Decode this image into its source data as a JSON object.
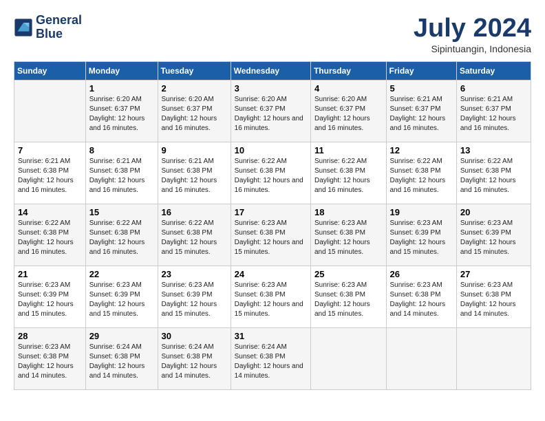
{
  "logo": {
    "line1": "General",
    "line2": "Blue"
  },
  "title": "July 2024",
  "subtitle": "Sipintuangin, Indonesia",
  "weekdays": [
    "Sunday",
    "Monday",
    "Tuesday",
    "Wednesday",
    "Thursday",
    "Friday",
    "Saturday"
  ],
  "weeks": [
    [
      {
        "day": "",
        "info": ""
      },
      {
        "day": "1",
        "info": "Sunrise: 6:20 AM\nSunset: 6:37 PM\nDaylight: 12 hours and 16 minutes."
      },
      {
        "day": "2",
        "info": "Sunrise: 6:20 AM\nSunset: 6:37 PM\nDaylight: 12 hours and 16 minutes."
      },
      {
        "day": "3",
        "info": "Sunrise: 6:20 AM\nSunset: 6:37 PM\nDaylight: 12 hours and 16 minutes."
      },
      {
        "day": "4",
        "info": "Sunrise: 6:20 AM\nSunset: 6:37 PM\nDaylight: 12 hours and 16 minutes."
      },
      {
        "day": "5",
        "info": "Sunrise: 6:21 AM\nSunset: 6:37 PM\nDaylight: 12 hours and 16 minutes."
      },
      {
        "day": "6",
        "info": "Sunrise: 6:21 AM\nSunset: 6:37 PM\nDaylight: 12 hours and 16 minutes."
      }
    ],
    [
      {
        "day": "7",
        "info": "Sunrise: 6:21 AM\nSunset: 6:38 PM\nDaylight: 12 hours and 16 minutes."
      },
      {
        "day": "8",
        "info": "Sunrise: 6:21 AM\nSunset: 6:38 PM\nDaylight: 12 hours and 16 minutes."
      },
      {
        "day": "9",
        "info": "Sunrise: 6:21 AM\nSunset: 6:38 PM\nDaylight: 12 hours and 16 minutes."
      },
      {
        "day": "10",
        "info": "Sunrise: 6:22 AM\nSunset: 6:38 PM\nDaylight: 12 hours and 16 minutes."
      },
      {
        "day": "11",
        "info": "Sunrise: 6:22 AM\nSunset: 6:38 PM\nDaylight: 12 hours and 16 minutes."
      },
      {
        "day": "12",
        "info": "Sunrise: 6:22 AM\nSunset: 6:38 PM\nDaylight: 12 hours and 16 minutes."
      },
      {
        "day": "13",
        "info": "Sunrise: 6:22 AM\nSunset: 6:38 PM\nDaylight: 12 hours and 16 minutes."
      }
    ],
    [
      {
        "day": "14",
        "info": "Sunrise: 6:22 AM\nSunset: 6:38 PM\nDaylight: 12 hours and 16 minutes."
      },
      {
        "day": "15",
        "info": "Sunrise: 6:22 AM\nSunset: 6:38 PM\nDaylight: 12 hours and 16 minutes."
      },
      {
        "day": "16",
        "info": "Sunrise: 6:22 AM\nSunset: 6:38 PM\nDaylight: 12 hours and 15 minutes."
      },
      {
        "day": "17",
        "info": "Sunrise: 6:23 AM\nSunset: 6:38 PM\nDaylight: 12 hours and 15 minutes."
      },
      {
        "day": "18",
        "info": "Sunrise: 6:23 AM\nSunset: 6:38 PM\nDaylight: 12 hours and 15 minutes."
      },
      {
        "day": "19",
        "info": "Sunrise: 6:23 AM\nSunset: 6:39 PM\nDaylight: 12 hours and 15 minutes."
      },
      {
        "day": "20",
        "info": "Sunrise: 6:23 AM\nSunset: 6:39 PM\nDaylight: 12 hours and 15 minutes."
      }
    ],
    [
      {
        "day": "21",
        "info": "Sunrise: 6:23 AM\nSunset: 6:39 PM\nDaylight: 12 hours and 15 minutes."
      },
      {
        "day": "22",
        "info": "Sunrise: 6:23 AM\nSunset: 6:39 PM\nDaylight: 12 hours and 15 minutes."
      },
      {
        "day": "23",
        "info": "Sunrise: 6:23 AM\nSunset: 6:39 PM\nDaylight: 12 hours and 15 minutes."
      },
      {
        "day": "24",
        "info": "Sunrise: 6:23 AM\nSunset: 6:38 PM\nDaylight: 12 hours and 15 minutes."
      },
      {
        "day": "25",
        "info": "Sunrise: 6:23 AM\nSunset: 6:38 PM\nDaylight: 12 hours and 15 minutes."
      },
      {
        "day": "26",
        "info": "Sunrise: 6:23 AM\nSunset: 6:38 PM\nDaylight: 12 hours and 14 minutes."
      },
      {
        "day": "27",
        "info": "Sunrise: 6:23 AM\nSunset: 6:38 PM\nDaylight: 12 hours and 14 minutes."
      }
    ],
    [
      {
        "day": "28",
        "info": "Sunrise: 6:23 AM\nSunset: 6:38 PM\nDaylight: 12 hours and 14 minutes."
      },
      {
        "day": "29",
        "info": "Sunrise: 6:24 AM\nSunset: 6:38 PM\nDaylight: 12 hours and 14 minutes."
      },
      {
        "day": "30",
        "info": "Sunrise: 6:24 AM\nSunset: 6:38 PM\nDaylight: 12 hours and 14 minutes."
      },
      {
        "day": "31",
        "info": "Sunrise: 6:24 AM\nSunset: 6:38 PM\nDaylight: 12 hours and 14 minutes."
      },
      {
        "day": "",
        "info": ""
      },
      {
        "day": "",
        "info": ""
      },
      {
        "day": "",
        "info": ""
      }
    ]
  ]
}
